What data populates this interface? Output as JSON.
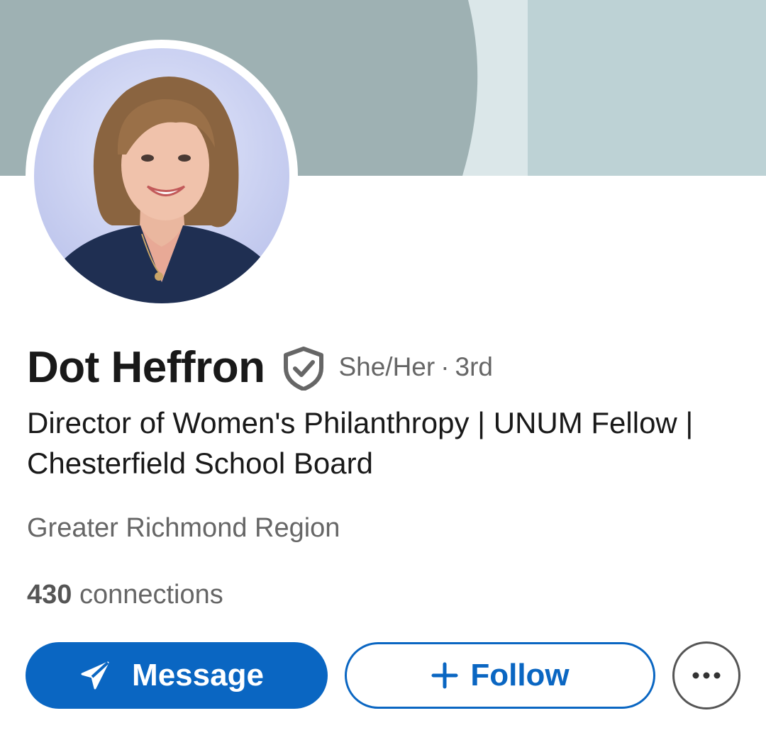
{
  "profile": {
    "name": "Dot Heffron",
    "verified_icon": "shield-check-icon",
    "pronouns": "She/Her",
    "separator": "·",
    "connection_degree": "3rd",
    "headline": "Director of Women's Philanthropy | UNUM Fellow | Chesterfield School Board",
    "location": "Greater Richmond Region",
    "connections_count": "430",
    "connections_label": "connections"
  },
  "actions": {
    "message_label": "Message",
    "message_icon": "send-icon",
    "follow_label": "Follow",
    "follow_icon": "plus-icon",
    "more_icon": "more-horizontal-icon"
  },
  "colors": {
    "accent": "#0a66c2",
    "banner_dark": "#9eb1b3",
    "banner_light": "#bdd2d5",
    "banner_stripe": "#dbe7e9",
    "text_primary": "#191919",
    "text_secondary": "#666666"
  }
}
